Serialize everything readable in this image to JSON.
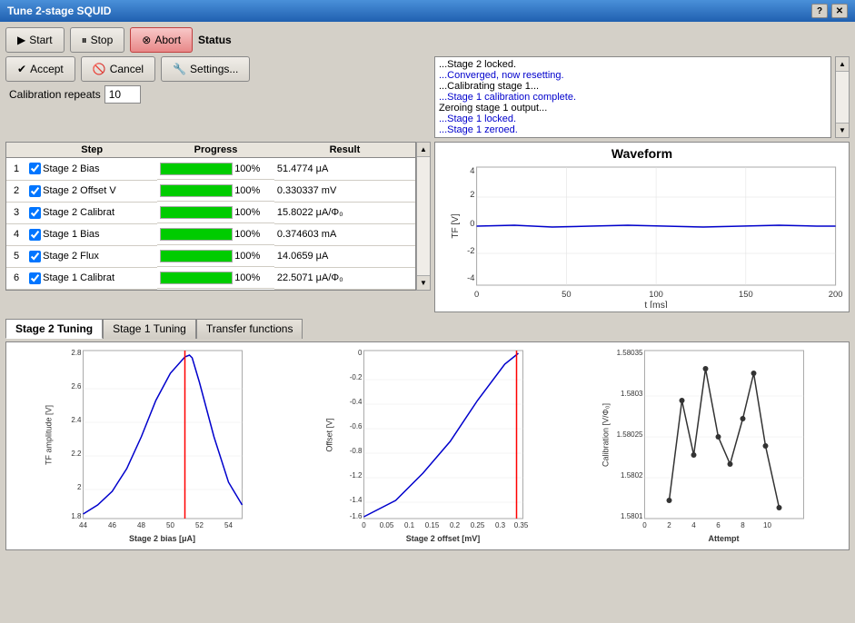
{
  "window": {
    "title": "Tune 2-stage SQUID"
  },
  "buttons": {
    "start": "Start",
    "stop": "Stop",
    "abort": "Abort",
    "accept": "Accept",
    "cancel": "Cancel",
    "settings": "Settings..."
  },
  "calibration": {
    "label": "Calibration repeats",
    "value": "10"
  },
  "status": {
    "label": "Status",
    "lines": [
      {
        "text": "...Stage 2 locked.",
        "type": "black"
      },
      {
        "text": "...Converged, now resetting.",
        "type": "blue"
      },
      {
        "text": "...Calibrating stage 1...",
        "type": "black"
      },
      {
        "text": "...Stage 1 calibration complete.",
        "type": "blue"
      },
      {
        "text": "Zeroing stage 1 output...",
        "type": "black"
      },
      {
        "text": "...Stage 1 locked.",
        "type": "blue"
      },
      {
        "text": "...Stage 1 zeroed.",
        "type": "blue"
      }
    ]
  },
  "table": {
    "headers": [
      "Step",
      "Progress",
      "Result"
    ],
    "rows": [
      {
        "num": 1,
        "checked": true,
        "step": "Stage 2 Bias",
        "pct": "100%",
        "result": "51.4774 μA"
      },
      {
        "num": 2,
        "checked": true,
        "step": "Stage 2 Offset V",
        "pct": "100%",
        "result": "0.330337 mV"
      },
      {
        "num": 3,
        "checked": true,
        "step": "Stage 2 Calibrat",
        "pct": "100%",
        "result": "15.8022 μA/Φ₀"
      },
      {
        "num": 4,
        "checked": true,
        "step": "Stage 1 Bias",
        "pct": "100%",
        "result": "0.374603 mA"
      },
      {
        "num": 5,
        "checked": true,
        "step": "Stage 2 Flux",
        "pct": "100%",
        "result": "14.0659 μA"
      },
      {
        "num": 6,
        "checked": true,
        "step": "Stage 1 Calibrat",
        "pct": "100%",
        "result": "22.5071 μA/Φ₀"
      }
    ]
  },
  "waveform": {
    "title": "Waveform",
    "y_label": "TF [V]",
    "x_label": "t [ms]",
    "y_range": [
      -4,
      4
    ],
    "x_range": [
      0,
      200
    ]
  },
  "tabs": [
    {
      "label": "Stage 2 Tuning",
      "active": true
    },
    {
      "label": "Stage 1 Tuning",
      "active": false
    },
    {
      "label": "Transfer functions",
      "active": false
    }
  ],
  "chart1": {
    "x_label": "Stage 2 bias [μA]",
    "y_label": "TF amplitude [V]",
    "x_min": 44,
    "x_max": 55,
    "red_line_x": 51.5
  },
  "chart2": {
    "x_label": "Stage 2 offset [mV]",
    "y_label": "Offset [V]",
    "x_min": 0,
    "x_max": 0.35,
    "red_line_x": 0.34
  },
  "chart3": {
    "x_label": "Attempt",
    "y_label": "Calibration [V/Φ₀]",
    "y_min": 1.5801,
    "y_max": 1.58035
  }
}
